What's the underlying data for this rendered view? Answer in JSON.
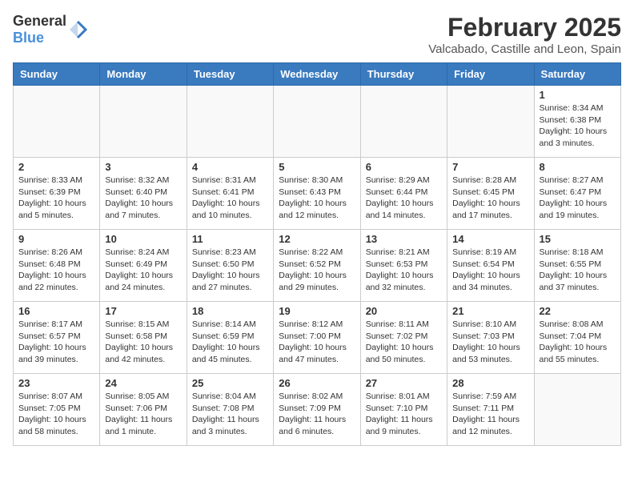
{
  "header": {
    "logo_general": "General",
    "logo_blue": "Blue",
    "main_title": "February 2025",
    "sub_title": "Valcabado, Castille and Leon, Spain"
  },
  "days_of_week": [
    "Sunday",
    "Monday",
    "Tuesday",
    "Wednesday",
    "Thursday",
    "Friday",
    "Saturday"
  ],
  "weeks": [
    [
      {
        "day": "",
        "info": ""
      },
      {
        "day": "",
        "info": ""
      },
      {
        "day": "",
        "info": ""
      },
      {
        "day": "",
        "info": ""
      },
      {
        "day": "",
        "info": ""
      },
      {
        "day": "",
        "info": ""
      },
      {
        "day": "1",
        "info": "Sunrise: 8:34 AM\nSunset: 6:38 PM\nDaylight: 10 hours and 3 minutes."
      }
    ],
    [
      {
        "day": "2",
        "info": "Sunrise: 8:33 AM\nSunset: 6:39 PM\nDaylight: 10 hours and 5 minutes."
      },
      {
        "day": "3",
        "info": "Sunrise: 8:32 AM\nSunset: 6:40 PM\nDaylight: 10 hours and 7 minutes."
      },
      {
        "day": "4",
        "info": "Sunrise: 8:31 AM\nSunset: 6:41 PM\nDaylight: 10 hours and 10 minutes."
      },
      {
        "day": "5",
        "info": "Sunrise: 8:30 AM\nSunset: 6:43 PM\nDaylight: 10 hours and 12 minutes."
      },
      {
        "day": "6",
        "info": "Sunrise: 8:29 AM\nSunset: 6:44 PM\nDaylight: 10 hours and 14 minutes."
      },
      {
        "day": "7",
        "info": "Sunrise: 8:28 AM\nSunset: 6:45 PM\nDaylight: 10 hours and 17 minutes."
      },
      {
        "day": "8",
        "info": "Sunrise: 8:27 AM\nSunset: 6:47 PM\nDaylight: 10 hours and 19 minutes."
      }
    ],
    [
      {
        "day": "9",
        "info": "Sunrise: 8:26 AM\nSunset: 6:48 PM\nDaylight: 10 hours and 22 minutes."
      },
      {
        "day": "10",
        "info": "Sunrise: 8:24 AM\nSunset: 6:49 PM\nDaylight: 10 hours and 24 minutes."
      },
      {
        "day": "11",
        "info": "Sunrise: 8:23 AM\nSunset: 6:50 PM\nDaylight: 10 hours and 27 minutes."
      },
      {
        "day": "12",
        "info": "Sunrise: 8:22 AM\nSunset: 6:52 PM\nDaylight: 10 hours and 29 minutes."
      },
      {
        "day": "13",
        "info": "Sunrise: 8:21 AM\nSunset: 6:53 PM\nDaylight: 10 hours and 32 minutes."
      },
      {
        "day": "14",
        "info": "Sunrise: 8:19 AM\nSunset: 6:54 PM\nDaylight: 10 hours and 34 minutes."
      },
      {
        "day": "15",
        "info": "Sunrise: 8:18 AM\nSunset: 6:55 PM\nDaylight: 10 hours and 37 minutes."
      }
    ],
    [
      {
        "day": "16",
        "info": "Sunrise: 8:17 AM\nSunset: 6:57 PM\nDaylight: 10 hours and 39 minutes."
      },
      {
        "day": "17",
        "info": "Sunrise: 8:15 AM\nSunset: 6:58 PM\nDaylight: 10 hours and 42 minutes."
      },
      {
        "day": "18",
        "info": "Sunrise: 8:14 AM\nSunset: 6:59 PM\nDaylight: 10 hours and 45 minutes."
      },
      {
        "day": "19",
        "info": "Sunrise: 8:12 AM\nSunset: 7:00 PM\nDaylight: 10 hours and 47 minutes."
      },
      {
        "day": "20",
        "info": "Sunrise: 8:11 AM\nSunset: 7:02 PM\nDaylight: 10 hours and 50 minutes."
      },
      {
        "day": "21",
        "info": "Sunrise: 8:10 AM\nSunset: 7:03 PM\nDaylight: 10 hours and 53 minutes."
      },
      {
        "day": "22",
        "info": "Sunrise: 8:08 AM\nSunset: 7:04 PM\nDaylight: 10 hours and 55 minutes."
      }
    ],
    [
      {
        "day": "23",
        "info": "Sunrise: 8:07 AM\nSunset: 7:05 PM\nDaylight: 10 hours and 58 minutes."
      },
      {
        "day": "24",
        "info": "Sunrise: 8:05 AM\nSunset: 7:06 PM\nDaylight: 11 hours and 1 minute."
      },
      {
        "day": "25",
        "info": "Sunrise: 8:04 AM\nSunset: 7:08 PM\nDaylight: 11 hours and 3 minutes."
      },
      {
        "day": "26",
        "info": "Sunrise: 8:02 AM\nSunset: 7:09 PM\nDaylight: 11 hours and 6 minutes."
      },
      {
        "day": "27",
        "info": "Sunrise: 8:01 AM\nSunset: 7:10 PM\nDaylight: 11 hours and 9 minutes."
      },
      {
        "day": "28",
        "info": "Sunrise: 7:59 AM\nSunset: 7:11 PM\nDaylight: 11 hours and 12 minutes."
      },
      {
        "day": "",
        "info": ""
      }
    ]
  ]
}
